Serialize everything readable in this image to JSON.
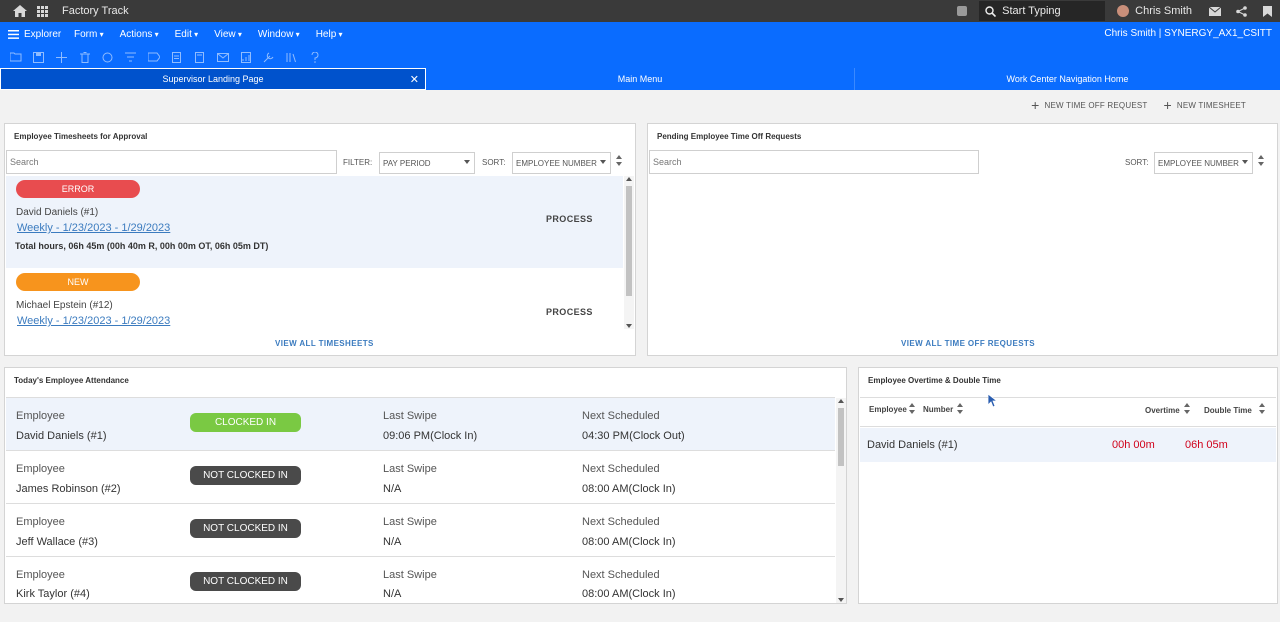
{
  "app": {
    "title": "Factory Track"
  },
  "topbar": {
    "search_placeholder": "Start Typing",
    "user_name": "Chris Smith"
  },
  "menubar": {
    "explorer": "Explorer",
    "items": [
      "Form",
      "Actions",
      "Edit",
      "View",
      "Window",
      "Help"
    ],
    "context": "Chris Smith | SYNERGY_AX1_CSITT"
  },
  "tabs": [
    {
      "label": "Supervisor Landing Page",
      "active": true
    },
    {
      "label": "Main Menu",
      "active": false
    },
    {
      "label": "Work Center Navigation Home",
      "active": false
    }
  ],
  "actions": {
    "new_time_off": "NEW TIME OFF REQUEST",
    "new_timesheet": "NEW TIMESHEET"
  },
  "timesheets": {
    "title": "Employee Timesheets for Approval",
    "search_placeholder": "Search",
    "filter_label": "FILTER:",
    "filter_value": "PAY PERIOD",
    "sort_label": "SORT:",
    "sort_value": "EMPLOYEE NUMBER",
    "rows": [
      {
        "status": "ERROR",
        "name": "David Daniels (#1)",
        "period": "Weekly - 1/23/2023 - 1/29/2023",
        "total": "Total hours, 06h 45m (00h 40m R, 00h 00m OT, 06h 05m DT)",
        "action": "PROCESS"
      },
      {
        "status": "NEW",
        "name": "Michael Epstein (#12)",
        "period": "Weekly - 1/23/2023 - 1/29/2023",
        "action": "PROCESS"
      }
    ],
    "view_all": "VIEW ALL TIMESHEETS"
  },
  "timeoff": {
    "title": "Pending Employee Time Off Requests",
    "search_placeholder": "Search",
    "sort_label": "SORT:",
    "sort_value": "EMPLOYEE NUMBER",
    "view_all": "VIEW ALL TIME OFF REQUESTS"
  },
  "attendance": {
    "title": "Today's Employee Attendance",
    "labels": {
      "employee": "Employee",
      "last_swipe": "Last Swipe",
      "next_scheduled": "Next Scheduled"
    },
    "rows": [
      {
        "employee": "David Daniels (#1)",
        "status": "CLOCKED IN",
        "last_swipe": "09:06 PM(Clock In)",
        "next": "04:30 PM(Clock Out)"
      },
      {
        "employee": "James Robinson (#2)",
        "status": "NOT CLOCKED IN",
        "last_swipe": "N/A",
        "next": "08:00 AM(Clock In)"
      },
      {
        "employee": "Jeff Wallace (#3)",
        "status": "NOT CLOCKED IN",
        "last_swipe": "N/A",
        "next": "08:00 AM(Clock In)"
      },
      {
        "employee": "Kirk Taylor (#4)",
        "status": "NOT CLOCKED IN",
        "last_swipe": "N/A",
        "next": "08:00 AM(Clock In)"
      }
    ]
  },
  "overtime": {
    "title": "Employee Overtime & Double Time",
    "headers": {
      "employee": "Employee",
      "number": "Number",
      "overtime": "Overtime",
      "double_time": "Double Time"
    },
    "rows": [
      {
        "employee": "David Daniels (#1)",
        "overtime": "00h 00m",
        "double_time": "06h 05m"
      }
    ]
  },
  "colors": {
    "brand_blue": "#0a6cff",
    "error": "#e84c4f",
    "new": "#f7941d",
    "clocked_in": "#7ac943",
    "not_clocked_in": "#4a4a4a",
    "link": "#3b7bbf",
    "overtime_red": "#d0021b"
  }
}
